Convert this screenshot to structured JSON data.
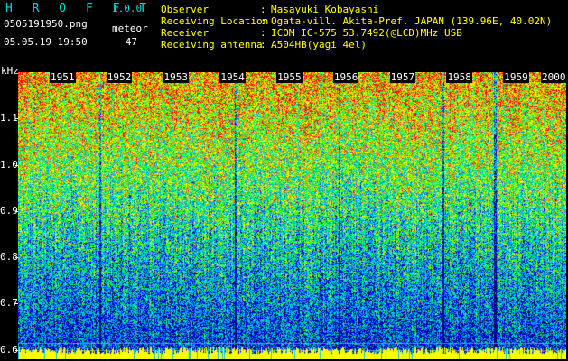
{
  "app": {
    "title": "H R O F F T",
    "version": "1.0.0"
  },
  "capture": {
    "file_name": "0505191950.png",
    "timestamp": "05.05.19 19:50",
    "mode_label": "meteor",
    "count": "47"
  },
  "station": [
    {
      "label": "Observer",
      "value": "Masayuki Kobayashi"
    },
    {
      "label": "Receiving Location",
      "value": "Ogata-vill. Akita-Pref. JAPAN (139.96E, 40.02N)"
    },
    {
      "label": "Receiver",
      "value": "ICOM IC-575 53.7492(@LCD)MHz USB"
    },
    {
      "label": "Receiving antenna",
      "value": "A504HB(yagi 4el)"
    }
  ],
  "colon": ":",
  "chart_data": {
    "type": "heatmap",
    "ylabel": "kHz",
    "ylim": [
      0.58,
      1.2
    ],
    "yticks": [
      "1.1",
      "1.0",
      "0.9",
      "0.8",
      "0.7",
      "0.6"
    ],
    "ytick_values": [
      1.1,
      1.0,
      0.9,
      0.8,
      0.7,
      0.6
    ],
    "time_labels": [
      "1951",
      "1952",
      "1953",
      "1954",
      "1955",
      "1956",
      "1957",
      "1958",
      "1959",
      "2000"
    ],
    "time_range_minutes": [
      0,
      10
    ],
    "colormap": [
      "#000080",
      "#0000ff",
      "#0080ff",
      "#00c0c0",
      "#00ff80",
      "#80ff00",
      "#ffff00",
      "#ff8000",
      "#ff0000"
    ],
    "baseline_color": "#ffff00"
  }
}
